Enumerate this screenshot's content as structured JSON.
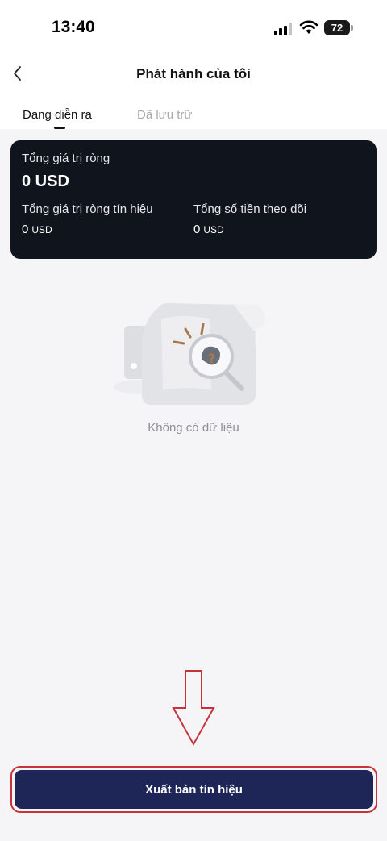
{
  "status_bar": {
    "time": "13:40",
    "battery_level": "72"
  },
  "nav": {
    "title": "Phát hành của tôi",
    "back_icon": "chevron-left-icon"
  },
  "tabs": [
    {
      "label": "Đang diễn ra",
      "active": true
    },
    {
      "label": "Đã lưu trữ",
      "active": false
    }
  ],
  "summary_card": {
    "net_value_label": "Tổng giá trị ròng",
    "net_value": "0 USD",
    "signal_net_value_label": "Tổng giá trị ròng tín hiệu",
    "signal_net_value_amount": "0",
    "signal_net_value_unit": "USD",
    "followed_total_label": "Tổng số tiền theo dõi",
    "followed_total_amount": "0",
    "followed_total_unit": "USD"
  },
  "empty_state": {
    "text": "Không có dữ liệu",
    "icon": "empty-document-magnifier-icon"
  },
  "footer": {
    "publish_label": "Xuất bản tín hiệu"
  },
  "colors": {
    "card_bg": "#10141d",
    "button_bg": "#1e2657",
    "highlight_border": "#c8333a",
    "annotation_arrow": "#c8333a"
  }
}
